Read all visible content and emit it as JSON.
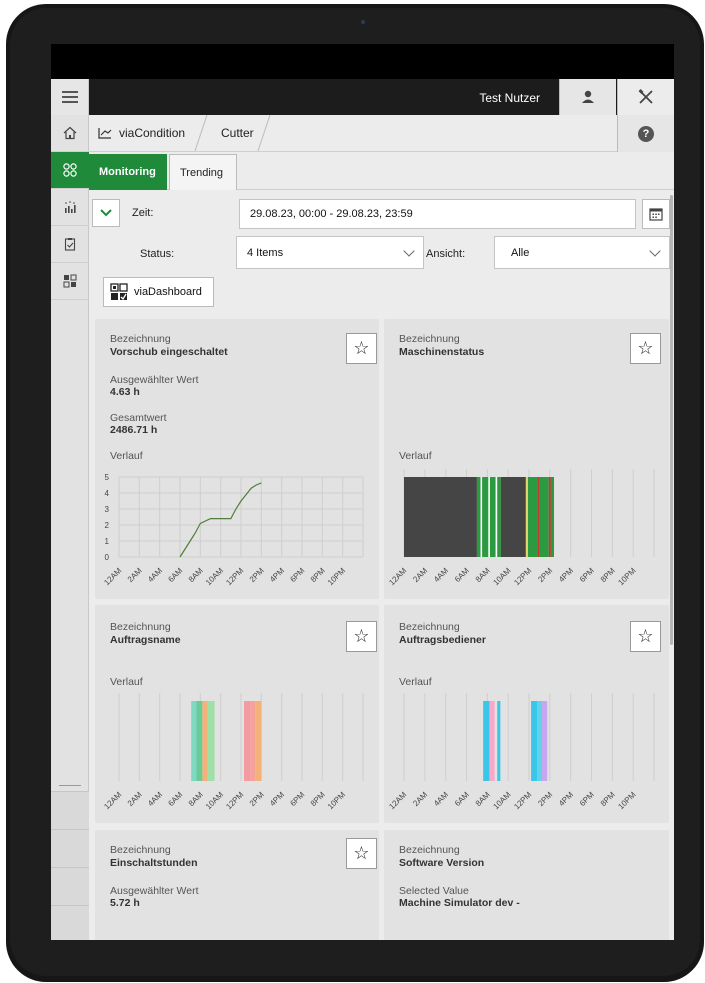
{
  "header": {
    "user_name": "Test Nutzer"
  },
  "breadcrumb": {
    "items": [
      "viaCondition",
      "Cutter"
    ]
  },
  "tabs": [
    {
      "label": "Monitoring",
      "active": true
    },
    {
      "label": "Trending",
      "active": false
    }
  ],
  "filters": {
    "zeit_label": "Zeit:",
    "zeit_value": "29.08.23, 00:00 - 29.08.23, 23:59",
    "status_label": "Status:",
    "status_value": "4 Items",
    "ansicht_label": "Ansicht:",
    "ansicht_value": "Alle",
    "dashboard_label": "viaDashboard"
  },
  "time_ticks": [
    "12AM",
    "2AM",
    "4AM",
    "6AM",
    "8AM",
    "10AM",
    "12PM",
    "2PM",
    "4PM",
    "6PM",
    "8PM",
    "10PM"
  ],
  "cards": [
    {
      "bez_label": "Bezeichnung",
      "name": "Vorschub eingeschaltet",
      "sel_label": "Ausgewählter Wert",
      "sel_value": "4.63 h",
      "total_label": "Gesamtwert",
      "total_value": "2486.71 h",
      "verlauf_label": "Verlauf"
    },
    {
      "bez_label": "Bezeichnung",
      "name": "Maschinenstatus",
      "verlauf_label": "Verlauf"
    },
    {
      "bez_label": "Bezeichnung",
      "name": "Auftragsname",
      "verlauf_label": "Verlauf"
    },
    {
      "bez_label": "Bezeichnung",
      "name": "Auftragsbediener",
      "verlauf_label": "Verlauf"
    },
    {
      "bez_label": "Bezeichnung",
      "name": "Einschaltstunden",
      "sel_label": "Ausgewählter Wert",
      "sel_value": "5.72 h"
    },
    {
      "bez_label": "Bezeichnung",
      "name": "Software Version",
      "sel_label": "Selected Value",
      "sel_value": "Machine Simulator dev -"
    }
  ],
  "chart_data": [
    {
      "type": "line",
      "title": "Vorschub eingeschaltet",
      "x": [
        "06:00",
        "06:30",
        "07:00",
        "07:30",
        "08:00",
        "09:00",
        "10:00",
        "10:30",
        "11:00",
        "11:30",
        "12:00",
        "12:30",
        "13:00",
        "13:30",
        "14:00"
      ],
      "series": [
        {
          "values": [
            0,
            0.5,
            1.0,
            1.5,
            2.1,
            2.4,
            2.4,
            2.4,
            2.4,
            3.0,
            3.5,
            3.9,
            4.3,
            4.5,
            4.63
          ]
        }
      ],
      "ylim": [
        0,
        5
      ],
      "yticks": [
        0,
        1,
        2,
        3,
        4,
        5
      ],
      "xlim": [
        "12AM",
        "12AM"
      ]
    },
    {
      "type": "bar",
      "title": "Maschinenstatus",
      "segments_hours": [
        {
          "start": 0,
          "end": 7.0,
          "color": "#454545"
        },
        {
          "start": 7.0,
          "end": 7.35,
          "color": "#2b9a41"
        },
        {
          "start": 7.35,
          "end": 7.5,
          "color": "#ffffff"
        },
        {
          "start": 7.5,
          "end": 8.1,
          "color": "#2b9a41"
        },
        {
          "start": 8.1,
          "end": 8.25,
          "color": "#ffffff"
        },
        {
          "start": 8.25,
          "end": 8.8,
          "color": "#2b9a41"
        },
        {
          "start": 8.8,
          "end": 8.95,
          "color": "#ffffff"
        },
        {
          "start": 8.95,
          "end": 9.3,
          "color": "#2b9a41"
        },
        {
          "start": 9.3,
          "end": 11.7,
          "color": "#454545"
        },
        {
          "start": 11.7,
          "end": 11.9,
          "color": "#e5d56a"
        },
        {
          "start": 11.9,
          "end": 12.8,
          "color": "#2b9a41"
        },
        {
          "start": 12.8,
          "end": 13.0,
          "color": "#c0392b"
        },
        {
          "start": 13.0,
          "end": 13.9,
          "color": "#2b9a41"
        },
        {
          "start": 13.9,
          "end": 14.1,
          "color": "#c0392b"
        },
        {
          "start": 14.1,
          "end": 14.4,
          "color": "#2b9a41"
        }
      ]
    },
    {
      "type": "bar",
      "title": "Auftragsname",
      "segments_hours": [
        {
          "start": 7.1,
          "end": 7.6,
          "color": "#7fd9c0"
        },
        {
          "start": 7.6,
          "end": 8.2,
          "color": "#66cc99"
        },
        {
          "start": 8.2,
          "end": 8.7,
          "color": "#f3b27a"
        },
        {
          "start": 8.7,
          "end": 9.4,
          "color": "#9fe0a8"
        },
        {
          "start": 12.3,
          "end": 12.9,
          "color": "#f59aa0"
        },
        {
          "start": 12.9,
          "end": 13.4,
          "color": "#f4a29a"
        },
        {
          "start": 13.4,
          "end": 14.0,
          "color": "#f3b27a"
        }
      ]
    },
    {
      "type": "bar",
      "title": "Auftragsbediener",
      "segments_hours": [
        {
          "start": 7.6,
          "end": 8.2,
          "color": "#39c6e8"
        },
        {
          "start": 8.2,
          "end": 8.7,
          "color": "#f8a8c8"
        },
        {
          "start": 8.95,
          "end": 9.25,
          "color": "#39c6e8"
        },
        {
          "start": 12.2,
          "end": 12.8,
          "color": "#39c6e8"
        },
        {
          "start": 12.8,
          "end": 13.25,
          "color": "#5ed4e8"
        },
        {
          "start": 13.25,
          "end": 13.75,
          "color": "#c8a6f2"
        }
      ]
    }
  ]
}
